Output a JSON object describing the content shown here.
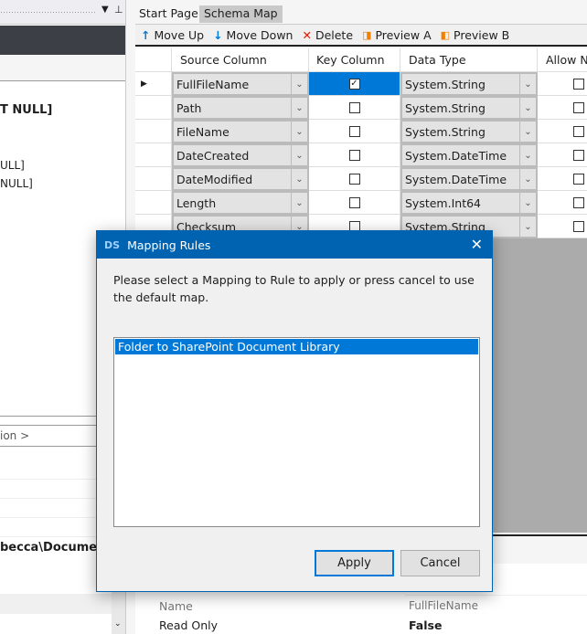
{
  "left_panel": {
    "lines": [
      "T NULL]",
      "ULL]",
      "NULL]"
    ],
    "breadcrumb_field": "ion >",
    "path_value": "becca\\Document"
  },
  "tabs": [
    {
      "label": "Start Page",
      "active": false
    },
    {
      "label": "Schema Map",
      "active": true
    }
  ],
  "toolbar": {
    "move_up": "Move Up",
    "move_down": "Move Down",
    "delete": "Delete",
    "preview_a": "Preview A",
    "preview_b": "Preview B"
  },
  "grid": {
    "columns": [
      "Source Column",
      "Key Column",
      "Data Type",
      "Allow N"
    ],
    "rows": [
      {
        "source": "FullFileName",
        "key": true,
        "type": "System.String",
        "allow": false,
        "current": true
      },
      {
        "source": "Path",
        "key": false,
        "type": "System.String",
        "allow": false
      },
      {
        "source": "FileName",
        "key": false,
        "type": "System.String",
        "allow": false
      },
      {
        "source": "DateCreated",
        "key": false,
        "type": "System.DateTime",
        "allow": false
      },
      {
        "source": "DateModified",
        "key": false,
        "type": "System.DateTime",
        "allow": false
      },
      {
        "source": "Length",
        "key": false,
        "type": "System.Int64",
        "allow": false
      },
      {
        "source": "Checksum",
        "key": false,
        "type": "System.String",
        "allow": false
      }
    ]
  },
  "properties": [
    {
      "name": "Name",
      "value": "FullFileName"
    },
    {
      "name": "Read Only",
      "value": "False"
    }
  ],
  "dialog": {
    "title": "Mapping Rules",
    "message": "Please select a Mapping to Rule to apply or press cancel to use the default map.",
    "items": [
      "Folder to SharePoint Document Library"
    ],
    "apply": "Apply",
    "cancel": "Cancel"
  },
  "colors": {
    "accent": "#0078d7",
    "titlebar": "#0063b1",
    "selection": "#0078d7"
  }
}
